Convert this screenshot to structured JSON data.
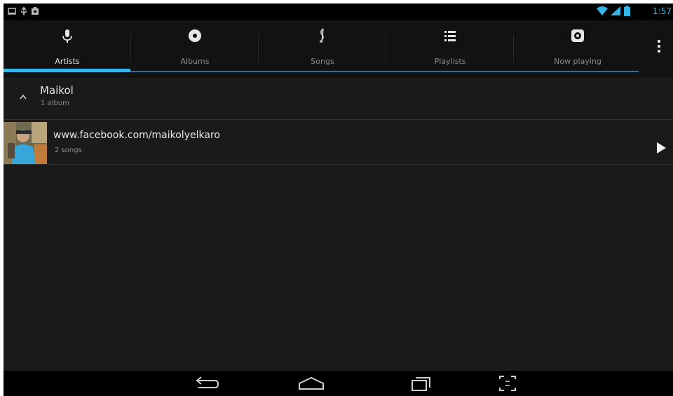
{
  "status_bar": {
    "time": "1:57",
    "left_icons": [
      "screenshot-icon",
      "usb-icon",
      "notification-icon"
    ],
    "right_icons": [
      "wifi-icon",
      "signal-icon",
      "battery-icon"
    ],
    "accent": "#33b5e5"
  },
  "tabs": [
    {
      "label": "Artists",
      "icon": "microphone-icon",
      "active": true
    },
    {
      "label": "Albums",
      "icon": "disc-icon",
      "active": false
    },
    {
      "label": "Songs",
      "icon": "music-note-icon",
      "active": false
    },
    {
      "label": "Playlists",
      "icon": "list-icon",
      "active": false
    },
    {
      "label": "Now playing",
      "icon": "now-playing-icon",
      "active": false
    }
  ],
  "overflow_menu_icon": "overflow-menu-icon",
  "artist_group": {
    "name": "Maikol",
    "album_count": "1 album",
    "expanded": true
  },
  "albums": [
    {
      "title": "www.facebook.com/maikolyelkaro",
      "song_count": "2 songs"
    }
  ],
  "nav_bar": {
    "buttons": [
      "back-icon",
      "home-icon",
      "recent-apps-icon",
      "screenshot-capture-icon"
    ]
  },
  "colors": {
    "accent": "#33b5e5",
    "background": "#1a1a1a",
    "tab_bar": "#121212",
    "text_primary": "#e6e6e6",
    "text_secondary": "#8c8c8c"
  }
}
